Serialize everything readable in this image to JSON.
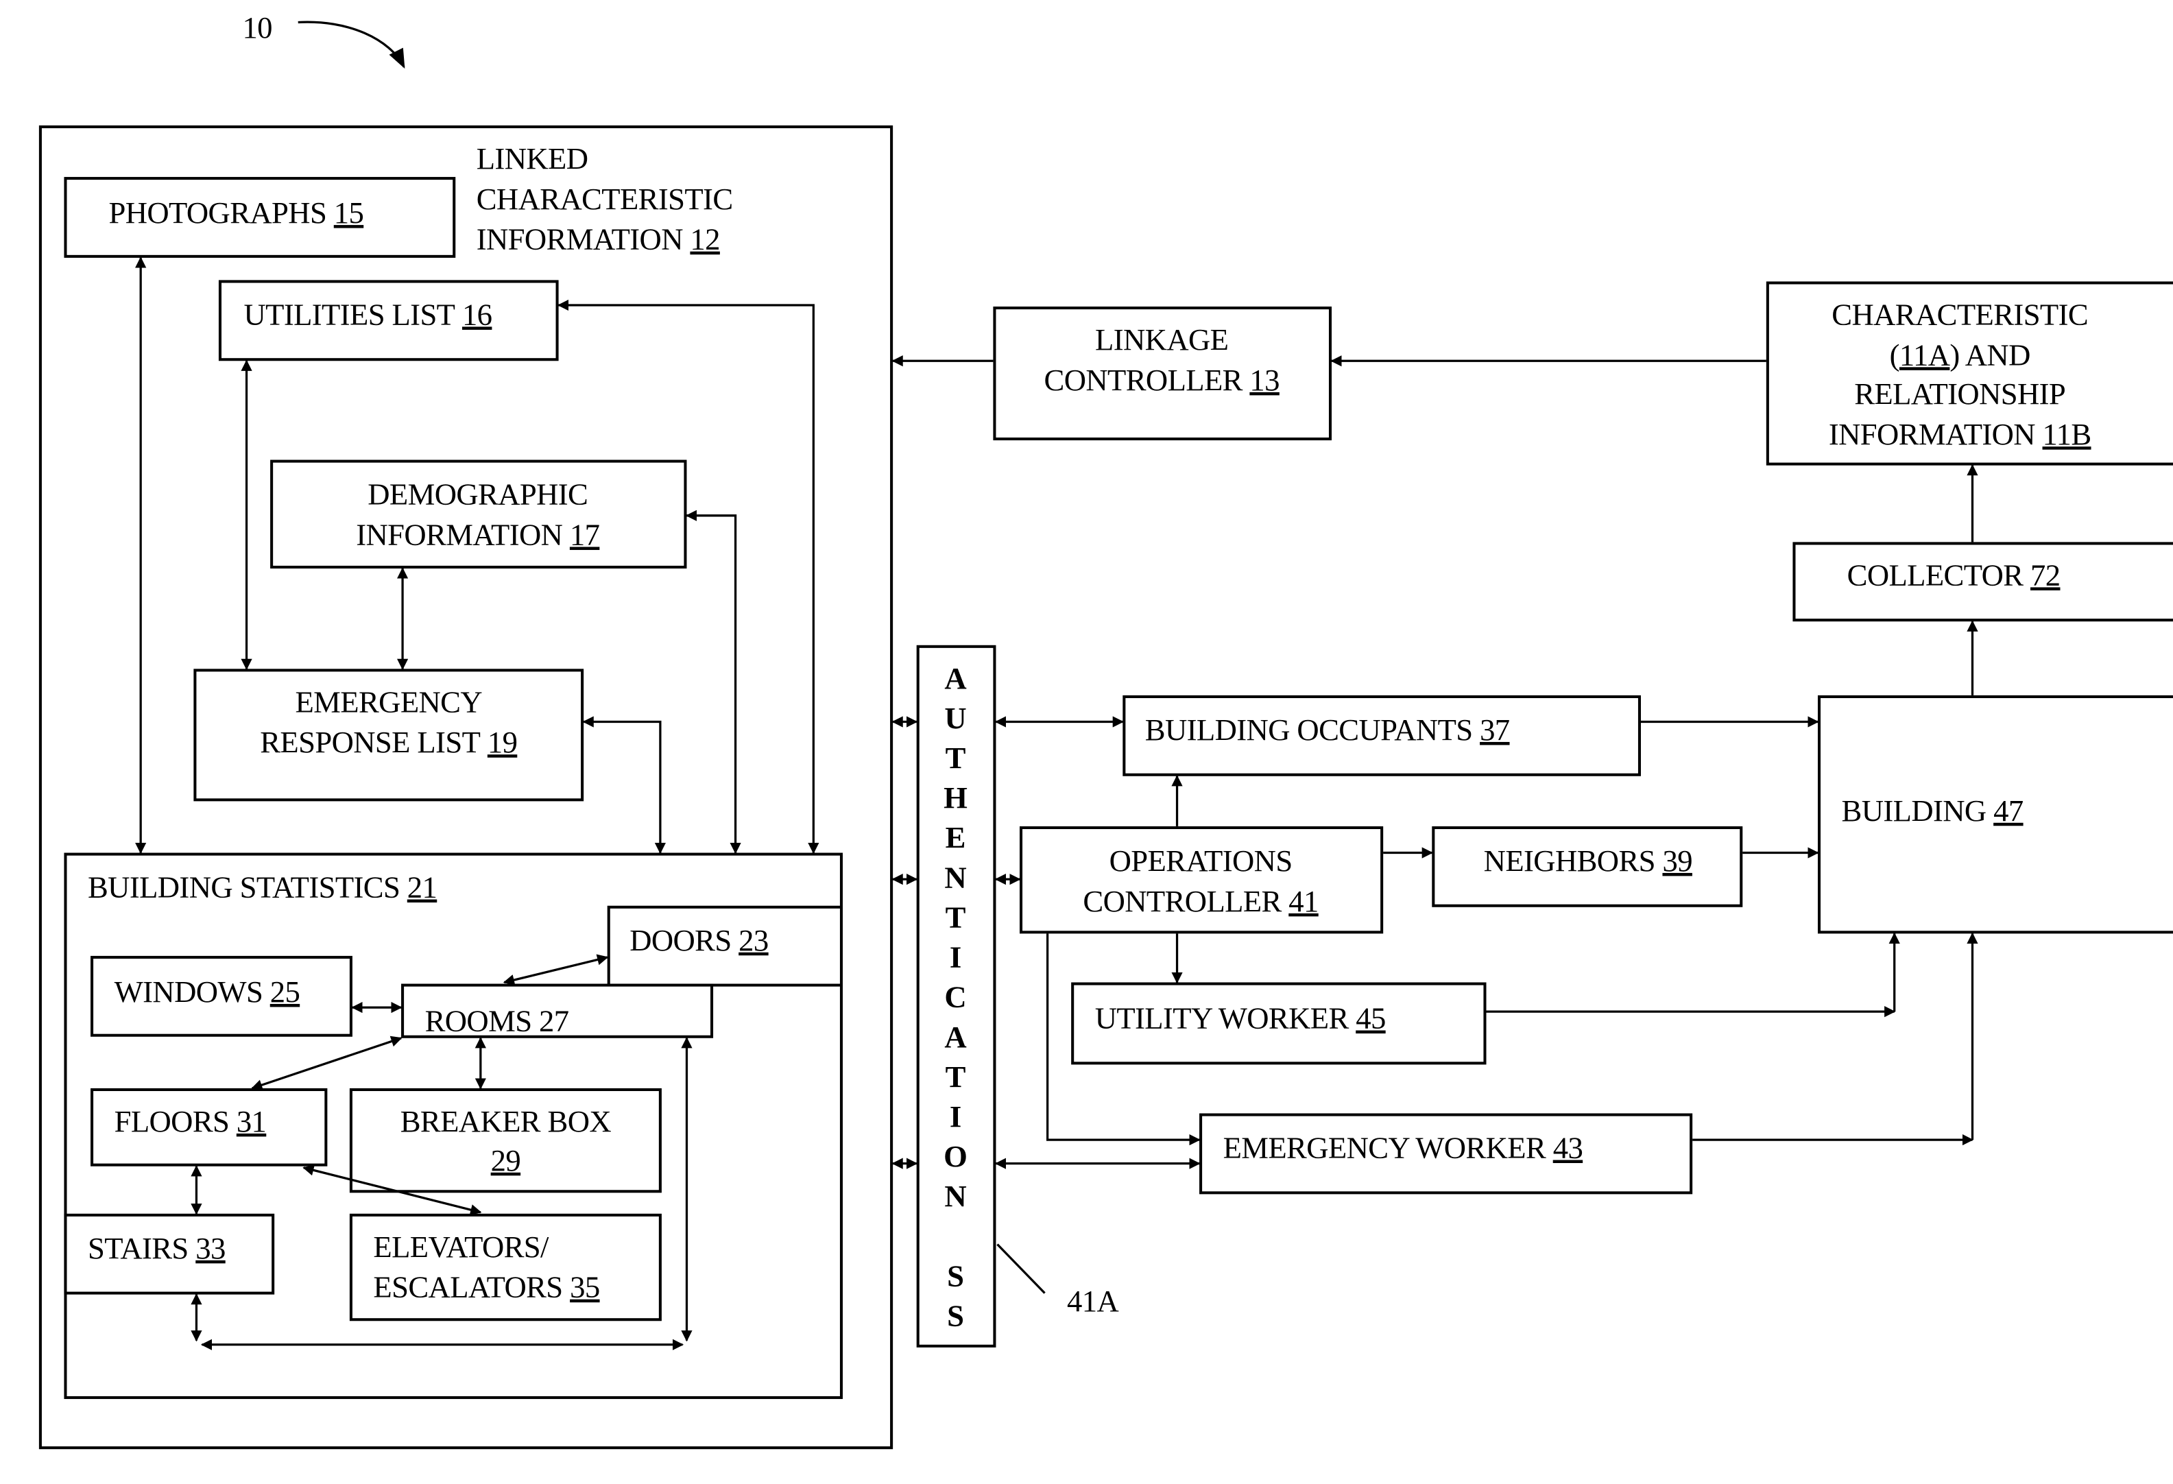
{
  "figure": {
    "ref_label": "10",
    "callout_41a": "41A"
  },
  "container": {
    "title_lines": [
      "LINKED",
      "CHARACTERISTIC",
      "INFORMATION"
    ],
    "title_ref": "12"
  },
  "blocks": {
    "photographs": {
      "lines": [
        "PHOTOGRAPHS"
      ],
      "ref": "15"
    },
    "utilities_list": {
      "lines": [
        "UTILITIES LIST"
      ],
      "ref": "16"
    },
    "demographic": {
      "lines": [
        "DEMOGRAPHIC",
        "INFORMATION"
      ],
      "ref": "17"
    },
    "emergency_response": {
      "lines": [
        "EMERGENCY",
        "RESPONSE LIST"
      ],
      "ref": "19"
    },
    "building_statistics": {
      "lines": [
        "BUILDING  STATISTICS"
      ],
      "ref": "21"
    },
    "doors": {
      "lines": [
        "DOORS"
      ],
      "ref": "23"
    },
    "windows": {
      "lines": [
        "WINDOWS"
      ],
      "ref": "25"
    },
    "rooms": {
      "lines": [
        "ROOMS"
      ],
      "ref": "27"
    },
    "floors": {
      "lines": [
        "FLOORS"
      ],
      "ref": "31"
    },
    "breaker_box": {
      "lines": [
        "BREAKER BOX"
      ],
      "ref": "29"
    },
    "stairs": {
      "lines": [
        "STAIRS"
      ],
      "ref": "33"
    },
    "elevators": {
      "lines": [
        "ELEVATORS/",
        "ESCALATORS"
      ],
      "ref": "35"
    },
    "linkage_controller": {
      "lines": [
        "LINKAGE",
        "CONTROLLER"
      ],
      "ref": "13"
    },
    "characteristic_info": {
      "lines": [
        "CHARACTERISTIC",
        "(11A) AND",
        "RELATIONSHIP",
        "INFORMATION"
      ],
      "ref": "11B",
      "inline_ref": "11A"
    },
    "collector": {
      "lines": [
        "COLLECTOR"
      ],
      "ref": "72"
    },
    "authentication": {
      "letters": [
        "A",
        "U",
        "T",
        "H",
        "E",
        "N",
        "T",
        "I",
        "C",
        "A",
        "T",
        "I",
        "O",
        "N",
        "",
        "S",
        "S"
      ]
    },
    "building_occupants": {
      "lines": [
        "BUILDING OCCUPANTS"
      ],
      "ref": "37"
    },
    "operations_controller": {
      "lines": [
        "OPERATIONS",
        "CONTROLLER"
      ],
      "ref": "41"
    },
    "neighbors": {
      "lines": [
        "NEIGHBORS"
      ],
      "ref": "39"
    },
    "building": {
      "lines": [
        "BUILDING"
      ],
      "ref": "47"
    },
    "utility_worker": {
      "lines": [
        "UTILITY WORKER"
      ],
      "ref": "45"
    },
    "emergency_worker": {
      "lines": [
        "EMERGENCY WORKER"
      ],
      "ref": "43"
    }
  }
}
